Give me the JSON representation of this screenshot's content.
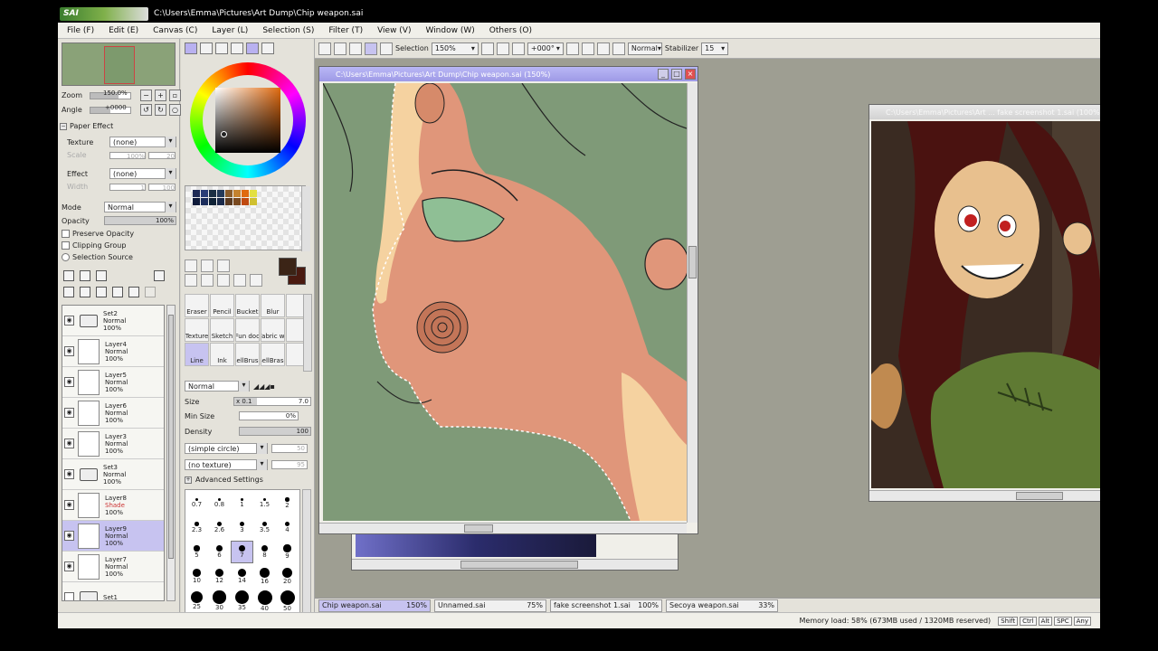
{
  "app": {
    "logo_text": "SAI",
    "title_path": "C:\\Users\\Emma\\Pictures\\Art Dump\\Chip weapon.sai"
  },
  "menu": [
    "File (F)",
    "Edit (E)",
    "Canvas (C)",
    "Layer (L)",
    "Selection (S)",
    "Filter (T)",
    "View (V)",
    "Window (W)",
    "Others (O)"
  ],
  "navigator": {
    "zoom_label": "Zoom",
    "zoom_value": "150.0%",
    "angle_label": "Angle",
    "angle_value": "+0000"
  },
  "paper_effect": {
    "heading": "Paper Effect",
    "texture_label": "Texture",
    "texture_value": "(none)",
    "scale_label": "Scale",
    "scale_value": "100%",
    "scale_num": "20",
    "effect_label": "Effect",
    "effect_value": "(none)",
    "width_label": "Width",
    "width_value": "1",
    "width_num": "100"
  },
  "layer_props": {
    "mode_label": "Mode",
    "mode_value": "Normal",
    "opacity_label": "Opacity",
    "opacity_value": "100%",
    "opacity_fraction": 1.0,
    "preserve_opacity": "Preserve Opacity",
    "clipping_group": "Clipping Group",
    "selection_source": "Selection Source"
  },
  "layers": [
    {
      "type": "folder",
      "name": "Set2",
      "blend": "Normal",
      "opacity": "100%",
      "visible": true,
      "selected": false
    },
    {
      "type": "layer",
      "name": "Layer4",
      "blend": "Normal",
      "opacity": "100%",
      "visible": true,
      "selected": false
    },
    {
      "type": "layer",
      "name": "Layer5",
      "blend": "Normal",
      "opacity": "100%",
      "visible": true,
      "selected": false
    },
    {
      "type": "layer",
      "name": "Layer6",
      "blend": "Normal",
      "opacity": "100%",
      "visible": true,
      "selected": false
    },
    {
      "type": "layer",
      "name": "Layer3",
      "blend": "Normal",
      "opacity": "100%",
      "visible": true,
      "selected": false
    },
    {
      "type": "folder",
      "name": "Set3",
      "blend": "Normal",
      "opacity": "100%",
      "visible": true,
      "selected": false
    },
    {
      "type": "layer",
      "name": "Layer8",
      "blend": "Shade",
      "opacity": "100%",
      "visible": true,
      "selected": false
    },
    {
      "type": "layer",
      "name": "Layer9",
      "blend": "Normal",
      "opacity": "100%",
      "visible": true,
      "selected": true
    },
    {
      "type": "layer",
      "name": "Layer7",
      "blend": "Normal",
      "opacity": "100%",
      "visible": true,
      "selected": false
    },
    {
      "type": "folder",
      "name": "Set1",
      "blend": "",
      "opacity": "",
      "visible": false,
      "selected": false
    }
  ],
  "colors": {
    "primary": "#3b2416",
    "secondary": "#4a1a10",
    "swatches": [
      "#1e2a55",
      "#2a3d77",
      "#1b2f44",
      "#243a5a",
      "#8a5c2b",
      "#c4822e",
      "#e06a10",
      "#e3e040"
    ]
  },
  "brushes": {
    "names": [
      "Eraser",
      "Pencil",
      "Bucket",
      "Blur",
      "",
      "Texture",
      "Sketch",
      "Fun doo",
      "Fabric wt",
      "",
      "Line",
      "Ink",
      "SellBrush",
      "SellBrase",
      ""
    ],
    "selected_index": 10,
    "blend_mode": "Normal",
    "size_label": "Size",
    "size_mult": "x 0.1",
    "size_value": "7.0",
    "min_size_label": "Min Size",
    "min_size_value": "0%",
    "density_label": "Density",
    "density_value": "100",
    "shape_value": "(simple circle)",
    "shape_num": "50",
    "texture_value": "(no texture)",
    "texture_num": "95",
    "advanced": "Advanced Settings",
    "tip_sizes": [
      "0.7",
      "0.8",
      "1",
      "1.5",
      "2",
      "2.3",
      "2.6",
      "3",
      "3.5",
      "4",
      "5",
      "6",
      "7",
      "8",
      "9",
      "10",
      "12",
      "14",
      "16",
      "20",
      "25",
      "30",
      "35",
      "40",
      "50"
    ]
  },
  "toolbar": {
    "selection_label": "Selection",
    "zoom_value": "150%",
    "rotation_value": "+000°",
    "mode_value": "Normal",
    "stabilizer_label": "Stabilizer",
    "stabilizer_value": "15"
  },
  "windows": {
    "main_title": "C:\\Users\\Emma\\Pictures\\Art Dump\\Chip weapon.sai (150%)",
    "ref_title": "C:\\Users\\Emma\\Pictures\\Art ... fake screenshot 1.sai (100%)"
  },
  "file_tabs": [
    {
      "name": "Chip weapon.sai",
      "zoom": "150%",
      "active": true
    },
    {
      "name": "Unnamed.sai",
      "zoom": "75%",
      "active": false
    },
    {
      "name": "fake screenshot 1.sai",
      "zoom": "100%",
      "active": false
    },
    {
      "name": "Secoya weapon.sai",
      "zoom": "33%",
      "active": false
    }
  ],
  "status": {
    "memory": "Memory load: 58% (673MB used / 1320MB reserved)",
    "keys": [
      "Shift",
      "Ctrl",
      "Alt",
      "SPC",
      "Any"
    ]
  }
}
